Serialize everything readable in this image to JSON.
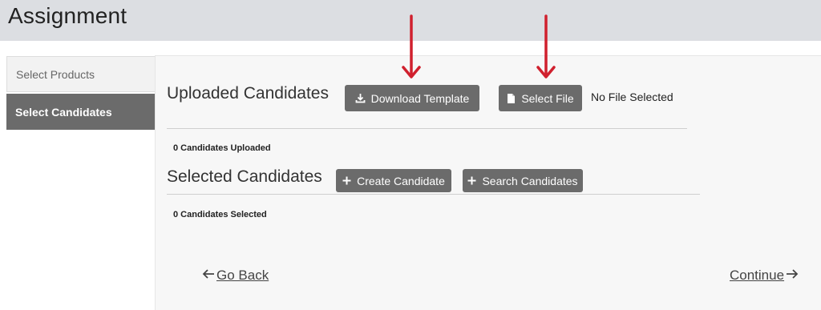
{
  "header": {
    "title": "Assignment"
  },
  "sidebar": {
    "items": [
      {
        "label": "Select Products"
      },
      {
        "label": "Select Candidates"
      }
    ]
  },
  "uploaded": {
    "title": "Uploaded Candidates",
    "download_label": "Download Template",
    "select_file_label": "Select File",
    "file_status": "No File Selected",
    "count_text": "0 Candidates Uploaded"
  },
  "selected": {
    "title": "Selected Candidates",
    "create_label": "Create Candidate",
    "search_label": "Search Candidates",
    "count_text": "0 Candidates Selected"
  },
  "nav": {
    "back_label": "Go Back",
    "continue_label": "Continue"
  },
  "colors": {
    "button": "#6b6b6b",
    "header_bg": "#dcdee2",
    "annotation_arrow": "#d0202e"
  }
}
